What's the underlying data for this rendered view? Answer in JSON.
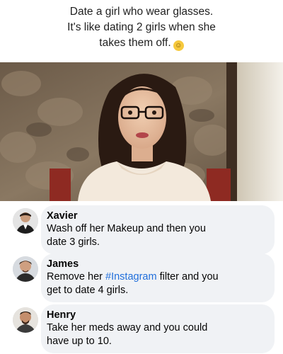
{
  "caption": {
    "line1": "Date a girl who wear glasses.",
    "line2": "It's like dating 2 girls when she",
    "line3": "takes them off.",
    "emoji_icon": "smiling-face-emoji"
  },
  "photo": {
    "subject": "woman-with-glasses-photo"
  },
  "comments": [
    {
      "name": "Xavier",
      "text_line1": "Wash off her Makeup and then you",
      "text_line2": "date 3 girls."
    },
    {
      "name": "James",
      "text_pre": "Remove her ",
      "hashtag": "#Instagram",
      "text_post": " filter and you",
      "text_line2": "get to date 4 girls."
    },
    {
      "name": "Henry",
      "text_line1": "Take her meds away and you could",
      "text_line2": "have up to 10."
    }
  ],
  "colors": {
    "bubble": "#f0f2f5",
    "hashtag": "#216fdb",
    "name": "#050505"
  }
}
